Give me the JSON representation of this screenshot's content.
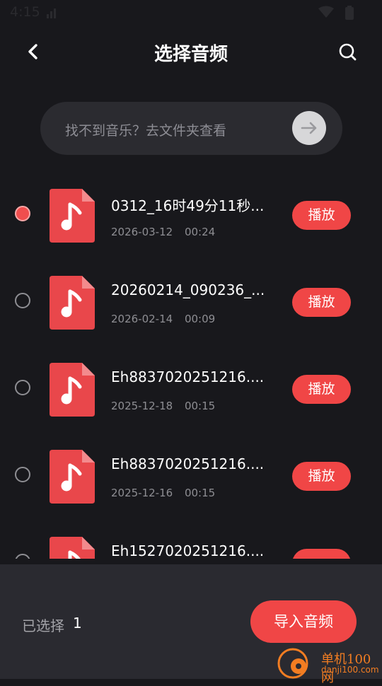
{
  "status_bar": {
    "time": "4:15"
  },
  "header": {
    "title": "选择音频"
  },
  "folder_hint": {
    "text": "找不到音乐？去文件夹查看"
  },
  "files": [
    {
      "name": "0312_16时49分11秒...",
      "date": "2026-03-12",
      "duration": "00:24",
      "play_label": "播放",
      "selected": true
    },
    {
      "name": "20260214_090236_...",
      "date": "2026-02-14",
      "duration": "00:09",
      "play_label": "播放",
      "selected": false
    },
    {
      "name": "Eh8837020251216....",
      "date": "2025-12-18",
      "duration": "00:15",
      "play_label": "播放",
      "selected": false
    },
    {
      "name": "Eh8837020251216....",
      "date": "2025-12-16",
      "duration": "00:15",
      "play_label": "播放",
      "selected": false
    },
    {
      "name": "Eh1527020251216....",
      "date": "",
      "duration": "",
      "play_label": "",
      "selected": false
    }
  ],
  "footer": {
    "selected_label": "已选择",
    "selected_count": "1",
    "import_label": "导入音频"
  },
  "watermark": {
    "name": "单机100网",
    "url": "danji100.com"
  },
  "colors": {
    "accent": "#f04646",
    "background": "#18181c",
    "footer_bg": "#2a2a30"
  }
}
